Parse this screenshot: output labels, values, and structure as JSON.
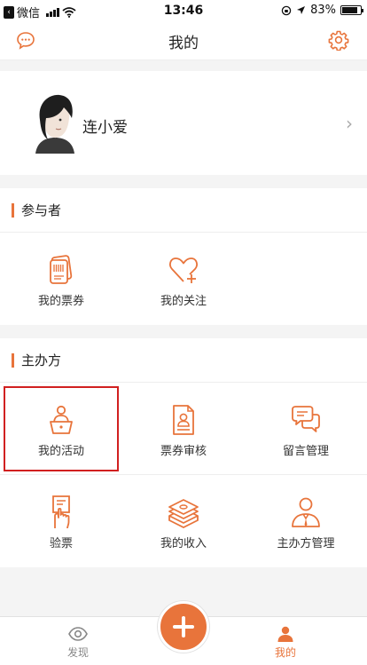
{
  "status_bar": {
    "carrier": "微信",
    "time": "13:46",
    "battery": "83%",
    "battery_level": 0.83
  },
  "nav": {
    "title": "我的",
    "left_icon": "message-icon",
    "right_icon": "gear-icon"
  },
  "profile": {
    "name": "连小爱",
    "chevron": "›"
  },
  "participant": {
    "title": "参与者",
    "items": [
      {
        "label": "我的票券",
        "icon": "ticket-icon"
      },
      {
        "label": "我的关注",
        "icon": "heart-plus-icon"
      }
    ]
  },
  "organizer": {
    "title": "主办方",
    "items": [
      {
        "label": "我的活动",
        "icon": "person-podium-icon"
      },
      {
        "label": "票券审核",
        "icon": "document-review-icon"
      },
      {
        "label": "留言管理",
        "icon": "chat-bubbles-icon"
      },
      {
        "label": "验票",
        "icon": "ticket-scan-icon"
      },
      {
        "label": "我的收入",
        "icon": "money-stack-icon"
      },
      {
        "label": "主办方管理",
        "icon": "person-manager-icon"
      }
    ]
  },
  "tab_bar": {
    "discover": "发现",
    "mine": "我的"
  },
  "colors": {
    "accent": "#e8743b",
    "highlight_box": "#d12020"
  }
}
